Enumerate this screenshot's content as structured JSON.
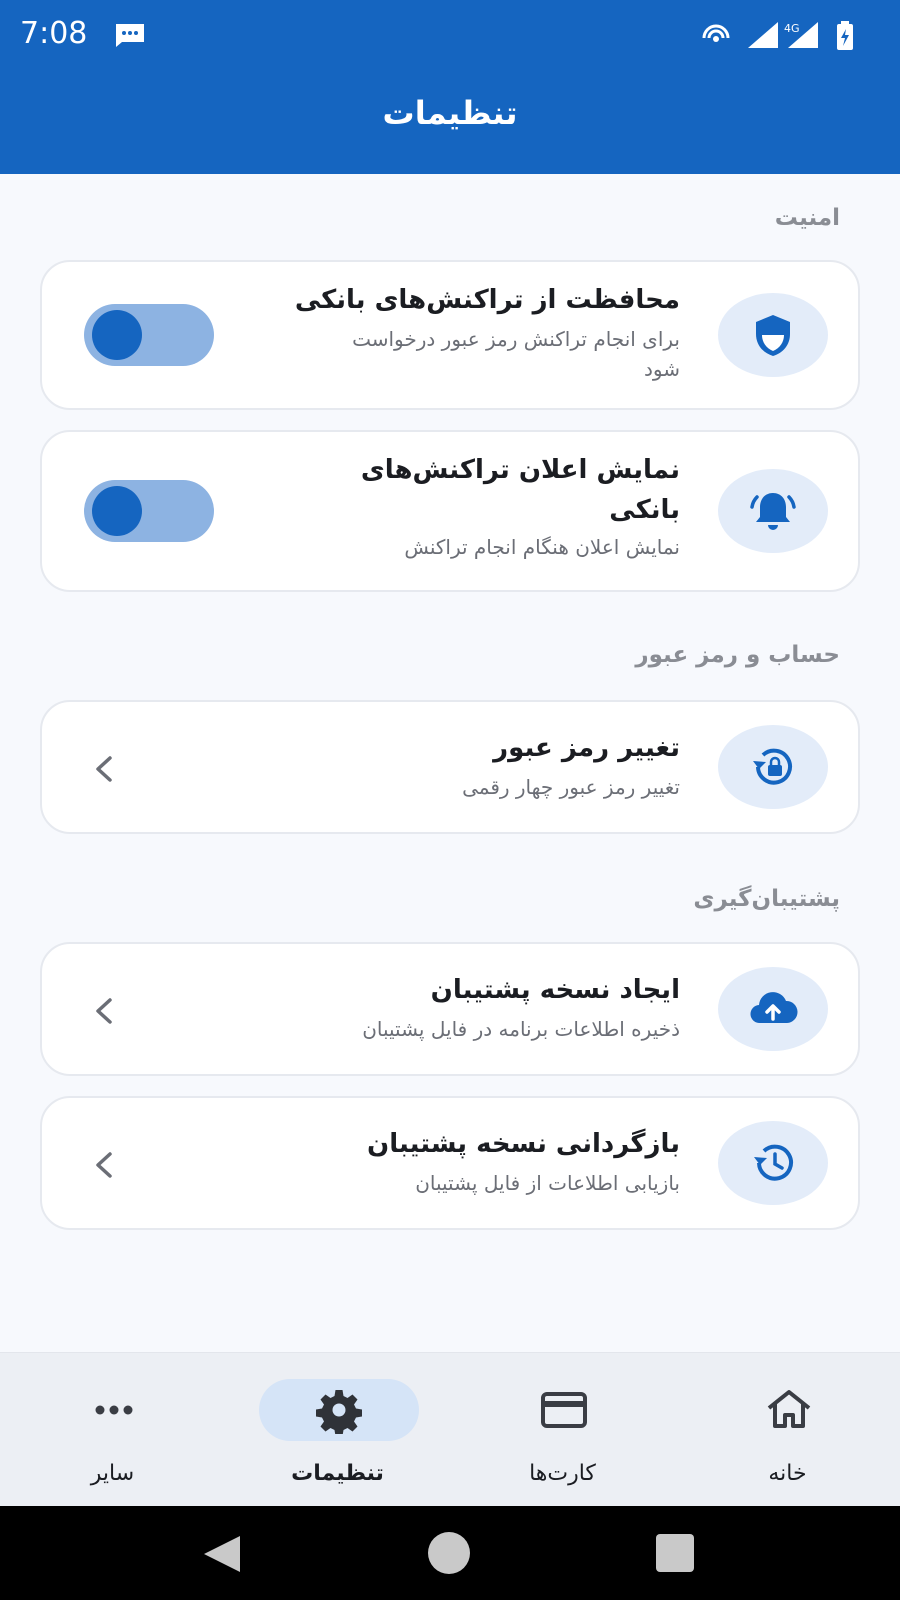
{
  "status_bar": {
    "time": "7:08",
    "network_label": "4G",
    "icons": [
      "message-icon",
      "hotspot-icon",
      "signal-icon",
      "signal-4g-icon",
      "battery-charging-icon"
    ]
  },
  "app_bar": {
    "title": "تنظیمات"
  },
  "sections": {
    "security": {
      "title": "امنیت",
      "items": [
        {
          "title": "محافظت از تراکنش‌های بانکی",
          "subtitle_line1": "برای انجام تراکنش رمز عبور درخواست",
          "subtitle_line2": "شود",
          "icon": "shield-icon",
          "toggle_on": true
        },
        {
          "title_line1": "نمایش اعلان تراکنش‌های",
          "title_line2": "بانکی",
          "subtitle": "نمایش اعلان هنگام انجام تراکنش",
          "icon": "bell-icon",
          "toggle_on": true
        }
      ]
    },
    "account": {
      "title": "حساب و رمز عبور",
      "items": [
        {
          "title": "تغییر رمز عبور",
          "subtitle": "تغییر رمز عبور چهار رقمی",
          "icon": "lock-reset-icon"
        }
      ]
    },
    "backup": {
      "title": "پشتیبان‌گیری",
      "items": [
        {
          "title": "ایجاد نسخه پشتیبان",
          "subtitle": "ذخیره اطلاعات برنامه در فایل پشتیبان",
          "icon": "cloud-upload-icon"
        },
        {
          "title": "بازگردانی نسخه پشتیبان",
          "subtitle": "بازیابی اطلاعات از فایل پشتیبان",
          "icon": "restore-icon"
        }
      ]
    }
  },
  "bottom_nav": {
    "items": [
      {
        "label": "خانه",
        "icon": "home-icon",
        "active": false
      },
      {
        "label": "کارت‌ها",
        "icon": "card-icon",
        "active": false
      },
      {
        "label": "تنظیمات",
        "icon": "gear-icon",
        "active": true
      },
      {
        "label": "سایر",
        "icon": "more-icon",
        "active": false
      }
    ]
  },
  "colors": {
    "primary": "#1565c0",
    "icon_bg": "#e3ecf9",
    "toggle_track": "#8db3e2",
    "nav_active_pill": "#d5e4f7",
    "background": "#f7f9fd"
  }
}
